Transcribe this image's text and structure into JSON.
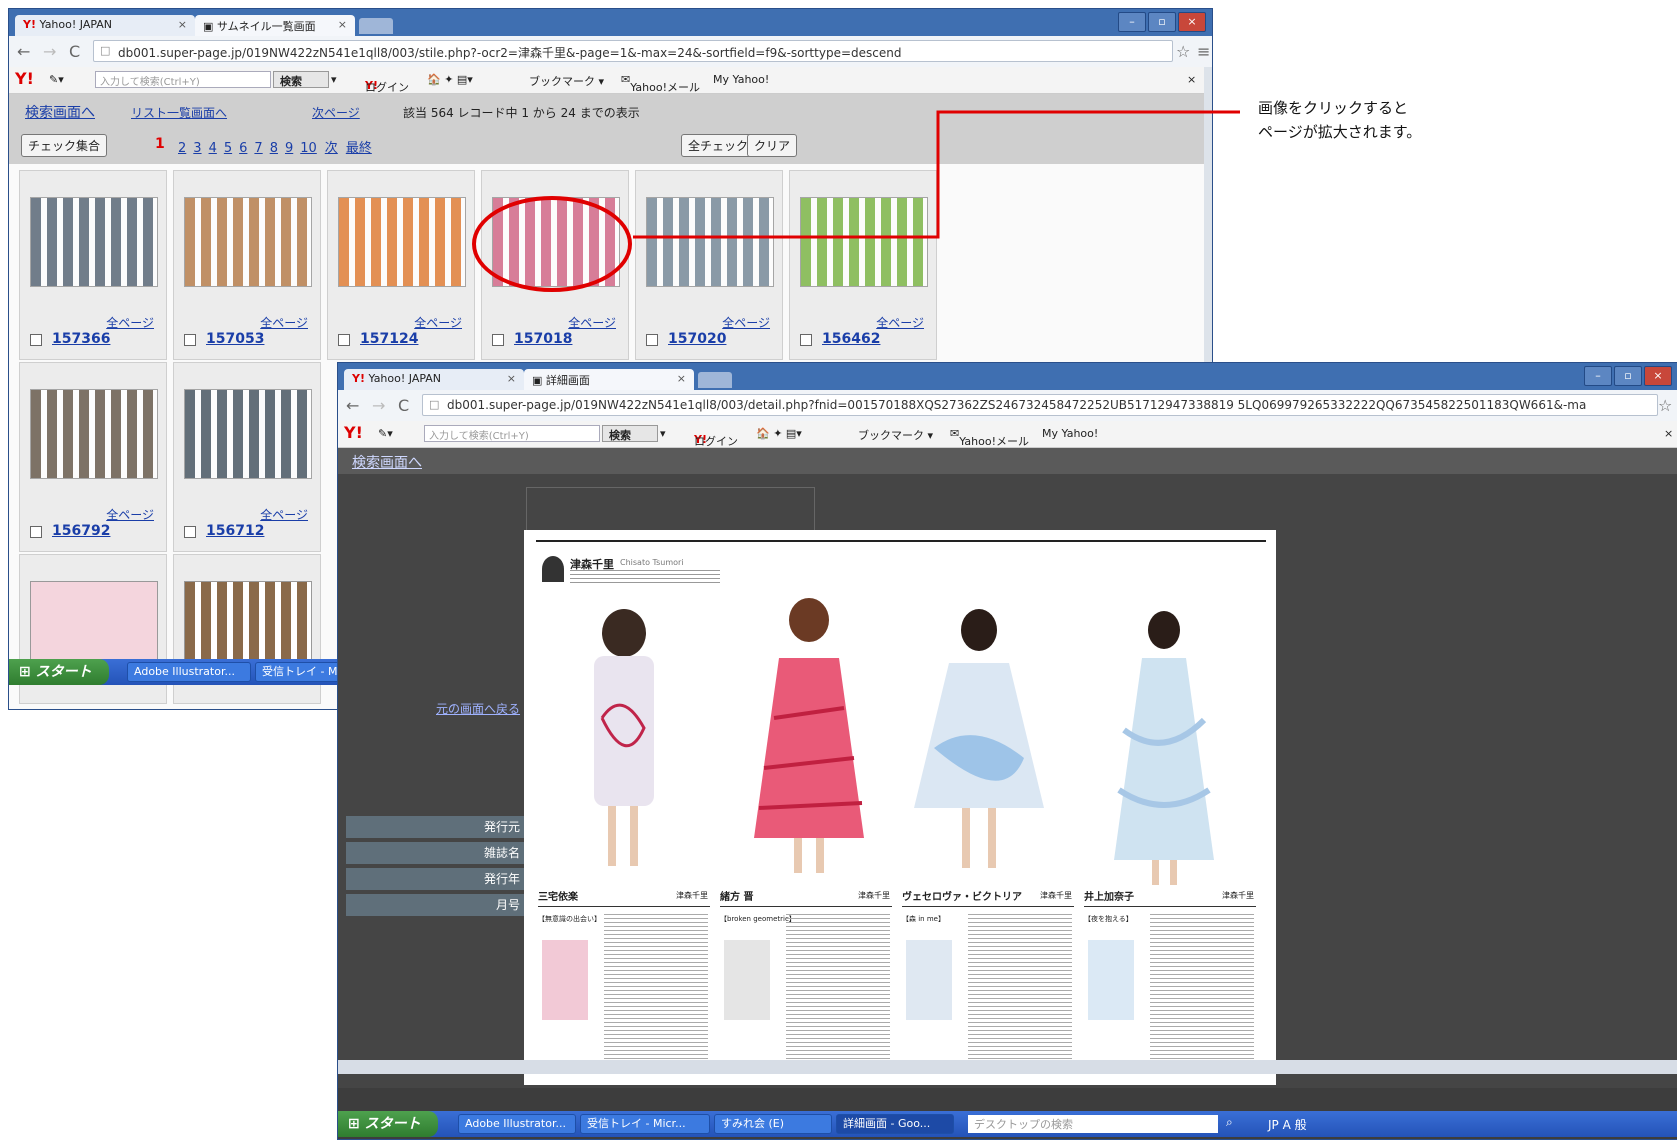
{
  "annotation": {
    "line1": "画像をクリックすると",
    "line2": "ページが拡大されます。",
    "color": "#e00000"
  },
  "back_window": {
    "tabs": [
      {
        "label": "Yahoo! JAPAN",
        "icon": "yahoo-favicon"
      },
      {
        "label": "サムネイル一覧画面",
        "icon": "page-favicon"
      }
    ],
    "url": "db001.super-page.jp/019NW422zN541e1qll8/003/stile.php?-ocr2=津森千里&-page=1&-max=24&-sortfield=f9&-sorttype=descend",
    "yahoo_toolbar": {
      "search_placeholder": "入力して検索(Ctrl+Y)",
      "search_button": "検索",
      "login": "ログイン",
      "bookmark": "ブックマーク ▾",
      "mail": "Yahoo!メール",
      "myyahoo": "My Yahoo!"
    },
    "nav": {
      "search_link": "検索画面へ",
      "list_link": "リスト一覧画面へ",
      "next_link": "次ページ",
      "status": "該当 564 レコード中 1 から 24 までの表示"
    },
    "controls": {
      "check_collect": "チェック集合",
      "current_page": "1",
      "pages": [
        "2",
        "3",
        "4",
        "5",
        "6",
        "7",
        "8",
        "9",
        "10"
      ],
      "next": "次",
      "last": "最終",
      "check_all": "全チェック",
      "clear": "クリア"
    },
    "thumbnails": [
      {
        "id": "157366",
        "all_pages": "全ページ"
      },
      {
        "id": "157053",
        "all_pages": "全ページ"
      },
      {
        "id": "157124",
        "all_pages": "全ページ"
      },
      {
        "id": "157018",
        "all_pages": "全ページ"
      },
      {
        "id": "157020",
        "all_pages": "全ページ"
      },
      {
        "id": "156462",
        "all_pages": "全ページ"
      },
      {
        "id": "156792",
        "all_pages": "全ページ"
      },
      {
        "id": "156712",
        "all_pages": "全ページ"
      }
    ],
    "taskbar": {
      "start": "スタート",
      "items": [
        "Adobe Illustrator...",
        "受信トレイ - M"
      ]
    }
  },
  "front_window": {
    "tabs": [
      {
        "label": "Yahoo! JAPAN",
        "icon": "yahoo-favicon"
      },
      {
        "label": "詳細画面",
        "icon": "page-favicon"
      }
    ],
    "url": "db001.super-page.jp/019NW422zN541e1qll8/003/detail.php?fnid=001570188XQS27362ZS246732458472252UB51712947338819 5LQ069979265332222QQ673545822501183QW661&-ma",
    "search_link": "検索画面へ",
    "back_link": "元の画面へ戻る",
    "info_labels": [
      "発行元",
      "雑誌名",
      "発行年",
      "月号"
    ],
    "magazine": {
      "designer": "津森千里",
      "designer_en": "Chisato Tsumori",
      "captions": [
        {
          "name": "三宅依楽",
          "who": "津森千里"
        },
        {
          "name": "緒方 晋",
          "who": "津森千里"
        },
        {
          "name": "ヴェセロヴァ・ビクトリア",
          "who": "津森千里"
        },
        {
          "name": "井上加奈子",
          "who": "津森千里"
        }
      ],
      "sub_labels": [
        "【無意識の出会い】",
        "【broken geometric】",
        "【森 in me】",
        "【夜を抱える】"
      ]
    },
    "taskbar": {
      "start": "スタート",
      "items": [
        "Adobe Illustrator...",
        "受信トレイ - Micr...",
        "すみれ会 (E)",
        "詳細画面 - Goo..."
      ],
      "desktop_search": "デスクトップの検索",
      "tray": "JP  A 般"
    }
  }
}
